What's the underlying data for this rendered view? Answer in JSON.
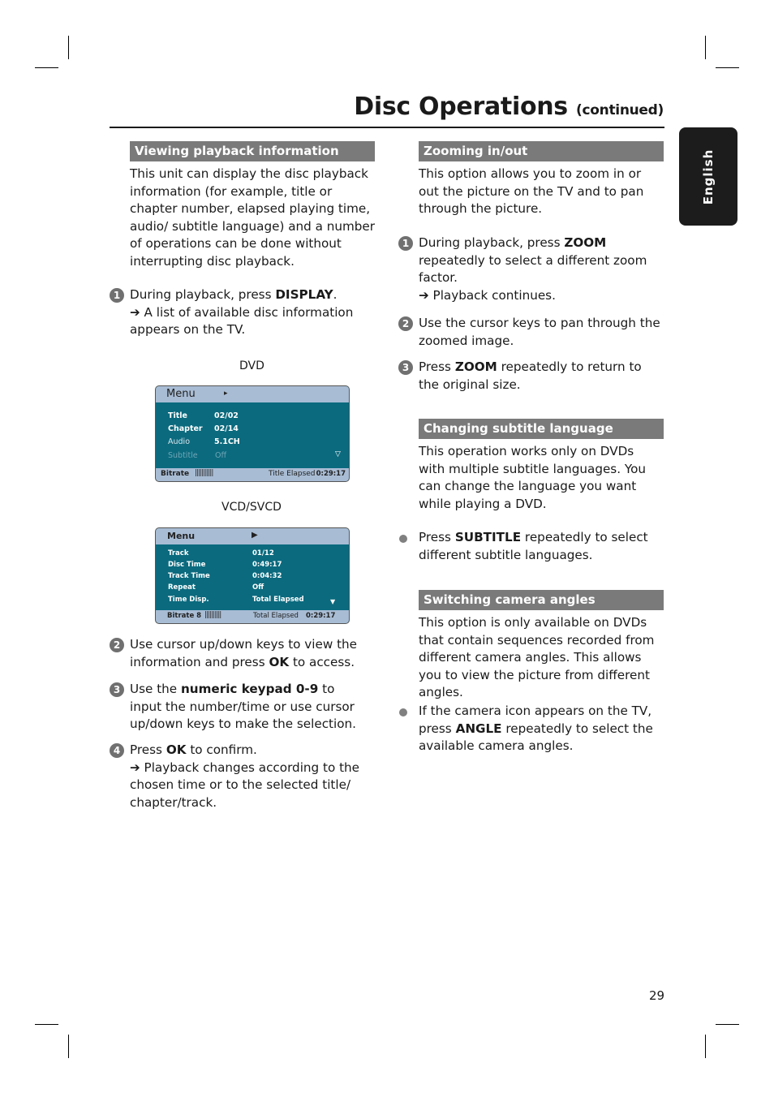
{
  "header": {
    "title": "Disc Operations",
    "continued": "(continued)"
  },
  "language_tab": "English",
  "page_number": "29",
  "left": {
    "section_title": "Viewing playback information",
    "intro": "This unit can display the disc playback information (for example, title or chapter number, elapsed playing time, audio/ subtitle language) and a number of operations can be done without interrupting disc playback.",
    "steps": [
      {
        "num": "1",
        "pre": "During playback, press ",
        "bold": "DISPLAY",
        "post": ".",
        "result": "➔ A list of available disc information appears on the TV."
      },
      {
        "num": "2",
        "pre": "Use cursor up/down keys to view the information and press ",
        "bold": "OK",
        "post": " to access."
      },
      {
        "num": "3",
        "pre": "Use the ",
        "bold": "numeric keypad 0-9",
        "post": " to input the number/time or use cursor up/down keys to make the selection."
      },
      {
        "num": "4",
        "pre": "Press ",
        "bold": "OK",
        "post": " to confirm.",
        "result": "➔ Playback changes according to the chosen time or to the selected title/ chapter/track."
      }
    ],
    "dvd_caption": "DVD",
    "dvd_osd": {
      "menu": "Menu",
      "arrow": "▸",
      "rows": [
        {
          "label": "Title",
          "value": "02/02"
        },
        {
          "label": "Chapter",
          "value": "02/14"
        },
        {
          "label": "Audio",
          "value": "5.1CH"
        },
        {
          "label": "Subtitle",
          "value": "Off"
        }
      ],
      "down_arrow": "▽",
      "bitrate_label": "Bitrate",
      "bitrate_bars": "|||||||||||",
      "elapsed_label": "Title Elapsed",
      "elapsed_value": "0:29:17"
    },
    "vcd_caption": "VCD/SVCD",
    "vcd_osd": {
      "menu": "Menu",
      "arrow": "▶",
      "rows": [
        {
          "label": "Track",
          "value": "01/12"
        },
        {
          "label": "Disc Time",
          "value": "0:49:17"
        },
        {
          "label": "Track Time",
          "value": "0:04:32"
        },
        {
          "label": "Repeat",
          "value": "Off"
        },
        {
          "label": "Time Disp.",
          "value": "Total Elapsed"
        }
      ],
      "down_arrow": "▼",
      "bitrate_label": "Bitrate 8",
      "bitrate_bars": "||||||||||",
      "elapsed_label": "Total Elapsed",
      "elapsed_value": "0:29:17"
    }
  },
  "right": {
    "zoom": {
      "section_title": "Zooming in/out",
      "intro": "This option allows you to zoom in or out the picture on the TV and to pan through the picture.",
      "steps": [
        {
          "num": "1",
          "pre": "During playback, press ",
          "bold": "ZOOM",
          "post": " repeatedly to select a different zoom factor.",
          "result": "➔ Playback continues."
        },
        {
          "num": "2",
          "pre": "Use the cursor keys to pan through the zoomed image.",
          "bold": "",
          "post": ""
        },
        {
          "num": "3",
          "pre": "Press ",
          "bold": "ZOOM",
          "post": " repeatedly to return to the original size."
        }
      ]
    },
    "subtitle": {
      "section_title": "Changing subtitle language",
      "intro": "This operation works only on DVDs with multiple subtitle languages. You can change the language you want while playing a DVD.",
      "bullet": {
        "pre": "Press ",
        "bold": "SUBTITLE",
        "post": " repeatedly to select different subtitle languages."
      }
    },
    "angle": {
      "section_title": "Switching camera angles",
      "intro": "This option is only available on DVDs that contain sequences recorded from different camera angles. This allows you to view the picture from different angles.",
      "bullet": {
        "pre": "If the camera icon appears on the TV, press ",
        "bold": "ANGLE",
        "post": " repeatedly to select the available camera angles."
      }
    }
  }
}
